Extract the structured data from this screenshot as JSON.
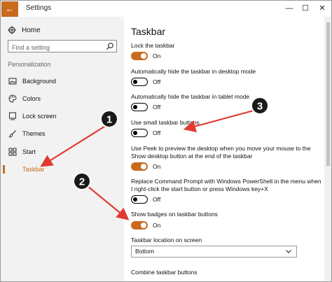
{
  "window": {
    "title": "Settings",
    "back_glyph": "←",
    "controls": {
      "minimize": "—",
      "maximize": "☐",
      "close": "✕"
    },
    "accent": "#c96b1c"
  },
  "sidebar": {
    "home": "Home",
    "search_placeholder": "Find a setting",
    "section": "Personalization",
    "items": [
      {
        "label": "Background",
        "icon": "picture-icon"
      },
      {
        "label": "Colors",
        "icon": "palette-icon"
      },
      {
        "label": "Lock screen",
        "icon": "lock-screen-icon"
      },
      {
        "label": "Themes",
        "icon": "brush-icon"
      },
      {
        "label": "Start",
        "icon": "start-grid-icon"
      },
      {
        "label": "Taskbar",
        "icon": "taskbar-icon",
        "active": true
      }
    ]
  },
  "main": {
    "title": "Taskbar",
    "options": [
      {
        "label": "Lock the taskbar",
        "state": "On"
      },
      {
        "label": "Automatically hide the taskbar in desktop mode",
        "state": "Off"
      },
      {
        "label": "Automatically hide the taskbar in tablet mode",
        "state": "Off"
      },
      {
        "label": "Use small taskbar buttons",
        "state": "Off"
      },
      {
        "label": "Use Peek to preview the desktop when you move your mouse to the Show desktop button at the end of the taskbar",
        "state": "On"
      },
      {
        "label": "Replace Command Prompt with Windows PowerShell in the menu when I right-click the start button or press Windows key+X",
        "state": "Off"
      },
      {
        "label": "Show badges on taskbar buttons",
        "state": "On"
      }
    ],
    "location_label": "Taskbar location on screen",
    "location_value": "Bottom",
    "combine_label": "Combine taskbar buttons"
  },
  "annotations": [
    {
      "number": "1",
      "color": "#e03a2f"
    },
    {
      "number": "2",
      "color": "#e03a2f"
    },
    {
      "number": "3",
      "color": "#e03a2f"
    }
  ]
}
